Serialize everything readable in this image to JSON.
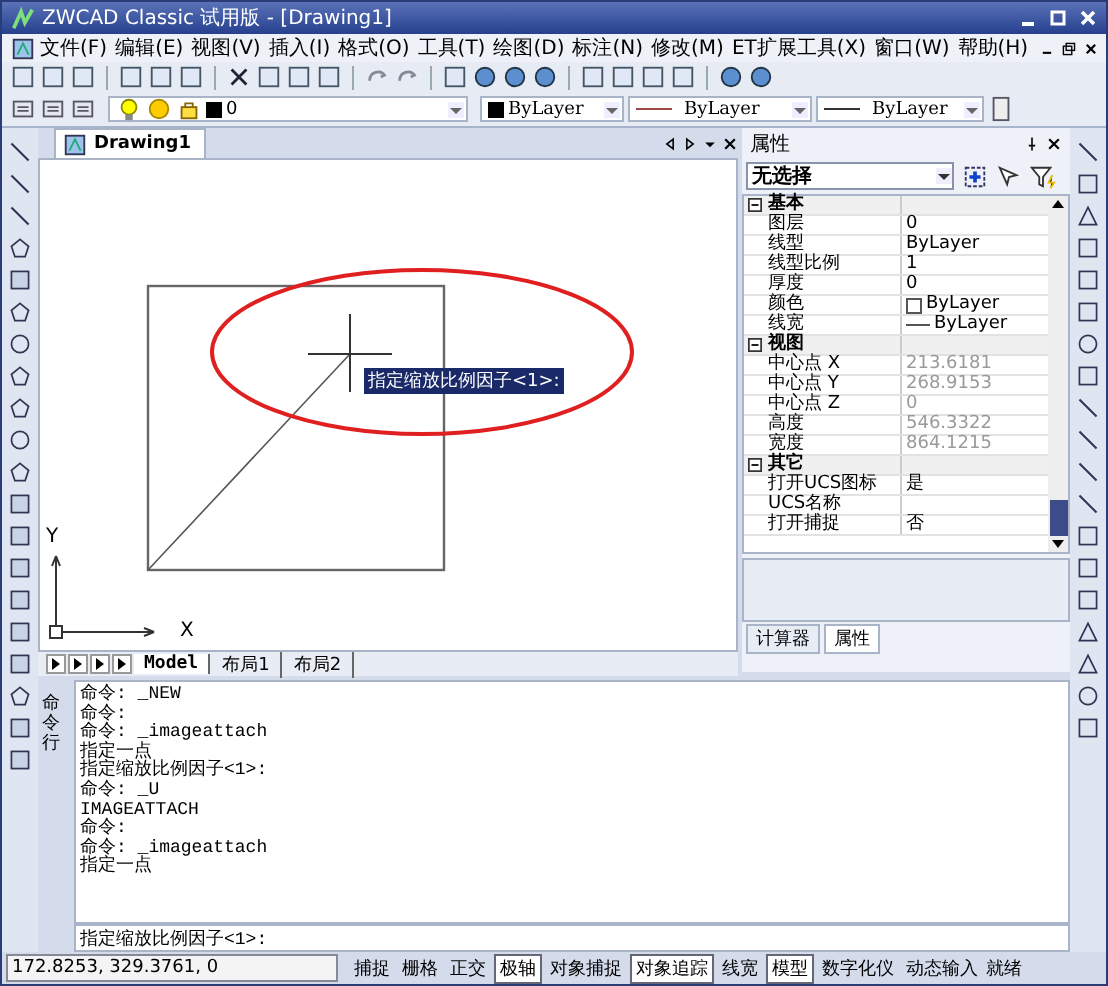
{
  "window": {
    "title": "ZWCAD Classic 试用版 - [Drawing1]"
  },
  "menu": [
    "文件(F)",
    "编辑(E)",
    "视图(V)",
    "插入(I)",
    "格式(O)",
    "工具(T)",
    "绘图(D)",
    "标注(N)",
    "修改(M)",
    "ET扩展工具(X)",
    "窗口(W)",
    "帮助(H)"
  ],
  "layer_bar": {
    "layer": "0",
    "color_setting": "ByLayer",
    "linetype": "ByLayer",
    "lineweight": "ByLayer"
  },
  "drawing": {
    "tab": "Drawing1",
    "prompt": "指定缩放比例因子<1>:",
    "axis_x": "X",
    "axis_y": "Y"
  },
  "layout_tabs": [
    {
      "label": "Model",
      "selected": true
    },
    {
      "label": "布局1",
      "selected": false
    },
    {
      "label": "布局2",
      "selected": false
    }
  ],
  "properties": {
    "title": "属性",
    "selection": "无选择",
    "sections": [
      {
        "title": "基本",
        "expanded": true,
        "rows": [
          {
            "name": "图层",
            "value": "0",
            "kind": "text",
            "disabled": false
          },
          {
            "name": "线型",
            "value": "ByLayer",
            "kind": "text",
            "disabled": false
          },
          {
            "name": "线型比例",
            "value": "1",
            "kind": "text",
            "disabled": false
          },
          {
            "name": "厚度",
            "value": "0",
            "kind": "text",
            "disabled": false
          },
          {
            "name": "颜色",
            "value": "ByLayer",
            "kind": "color",
            "disabled": false
          },
          {
            "name": "线宽",
            "value": "ByLayer",
            "kind": "lineweight",
            "disabled": false
          }
        ]
      },
      {
        "title": "视图",
        "expanded": true,
        "rows": [
          {
            "name": "中心点 X",
            "value": "213.6181",
            "kind": "text",
            "disabled": true
          },
          {
            "name": "中心点 Y",
            "value": "268.9153",
            "kind": "text",
            "disabled": true
          },
          {
            "name": "中心点 Z",
            "value": "0",
            "kind": "text",
            "disabled": true
          },
          {
            "name": "高度",
            "value": "546.3322",
            "kind": "text",
            "disabled": true
          },
          {
            "name": "宽度",
            "value": "864.1215",
            "kind": "text",
            "disabled": true
          }
        ]
      },
      {
        "title": "其它",
        "expanded": true,
        "rows": [
          {
            "name": "打开UCS图标",
            "value": "是",
            "kind": "text",
            "disabled": false
          },
          {
            "name": "UCS名称",
            "kind": "text",
            "disabled": false
          },
          {
            "name": "打开捕捉",
            "value": "否",
            "kind": "text",
            "disabled": false
          }
        ]
      }
    ],
    "tabs": [
      {
        "label": "计算器",
        "selected": false
      },
      {
        "label": "属性",
        "selected": true
      }
    ]
  },
  "command": {
    "label": "命令行",
    "history": [
      "命令: _NEW",
      "命令:",
      "命令: _imageattach",
      "指定一点",
      "指定缩放比例因子<1>:",
      "命令: _U",
      "IMAGEATTACH",
      "命令:",
      "命令: _imageattach",
      "指定一点"
    ],
    "input": "指定缩放比例因子<1>:"
  },
  "status_bar": {
    "coords": "172.8253,  329.3761,  0",
    "toggles": [
      {
        "label": "捕捉",
        "on": false
      },
      {
        "label": "栅格",
        "on": false
      },
      {
        "label": "正交",
        "on": false
      },
      {
        "label": "极轴",
        "on": true
      },
      {
        "label": "对象捕捉",
        "on": false
      },
      {
        "label": "对象追踪",
        "on": true
      },
      {
        "label": "线宽",
        "on": false
      },
      {
        "label": "模型",
        "on": true
      },
      {
        "label": "数字化仪",
        "on": false
      },
      {
        "label": "动态输入",
        "on": false
      }
    ],
    "state": "就绪"
  }
}
